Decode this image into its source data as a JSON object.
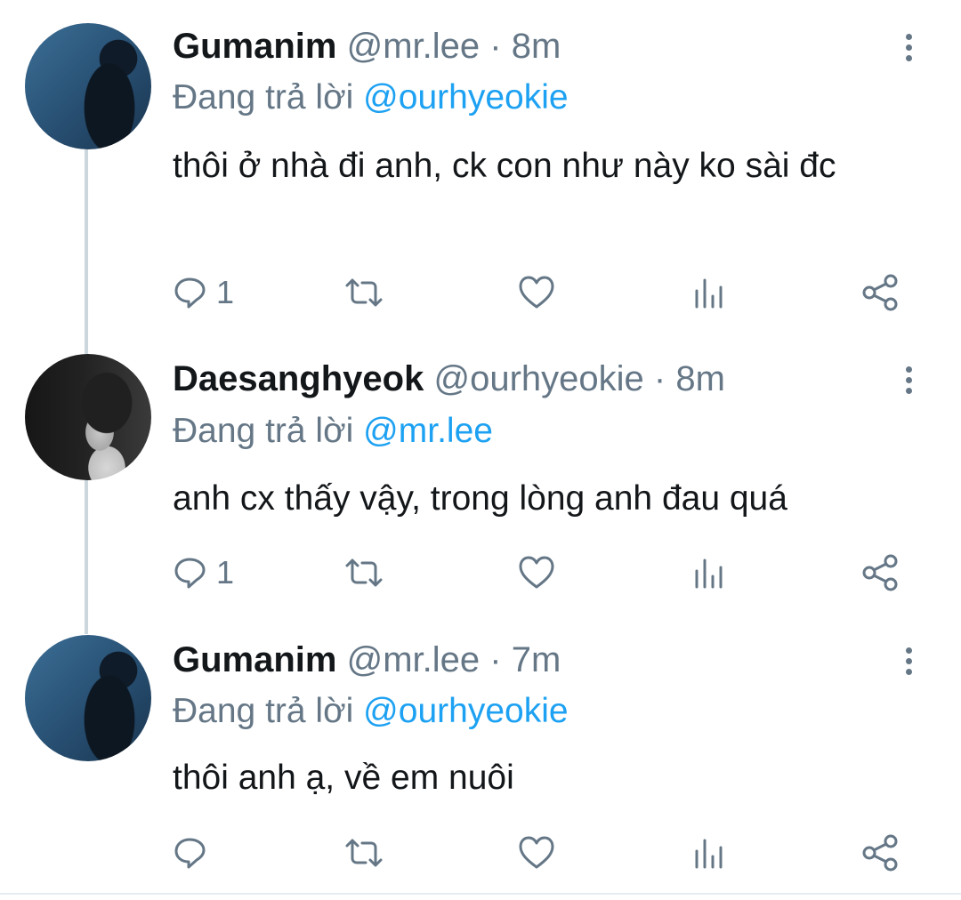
{
  "tweets": [
    {
      "name": "Gumanim",
      "handle": "@mr.lee",
      "separator": "·",
      "time": "8m",
      "reply_prefix": "Đang trả lời",
      "reply_to": "@ourhyeokie",
      "text": "thôi ở nhà đi anh, ck con như này ko sài đc",
      "reply_count": "1"
    },
    {
      "name": "Daesanghyeok",
      "handle": "@ourhyeokie",
      "separator": "·",
      "time": "8m",
      "reply_prefix": "Đang trả lời",
      "reply_to": "@mr.lee",
      "text": "anh cx thấy vậy, trong lòng anh đau quá",
      "reply_count": "1"
    },
    {
      "name": "Gumanim",
      "handle": "@mr.lee",
      "separator": "·",
      "time": "7m",
      "reply_prefix": "Đang trả lời",
      "reply_to": "@ourhyeokie",
      "text": "thôi anh ạ, về em nuôi",
      "reply_count": ""
    }
  ],
  "icons": {
    "reply": "reply-icon",
    "retweet": "retweet-icon",
    "like": "heart-icon",
    "analytics": "analytics-icon",
    "share": "share-icon",
    "menu": "more-vertical-icon"
  },
  "colors": {
    "text": "#14171a",
    "secondary": "#657786",
    "mention": "#1da1f2",
    "thread_line": "#ccd6dd"
  }
}
